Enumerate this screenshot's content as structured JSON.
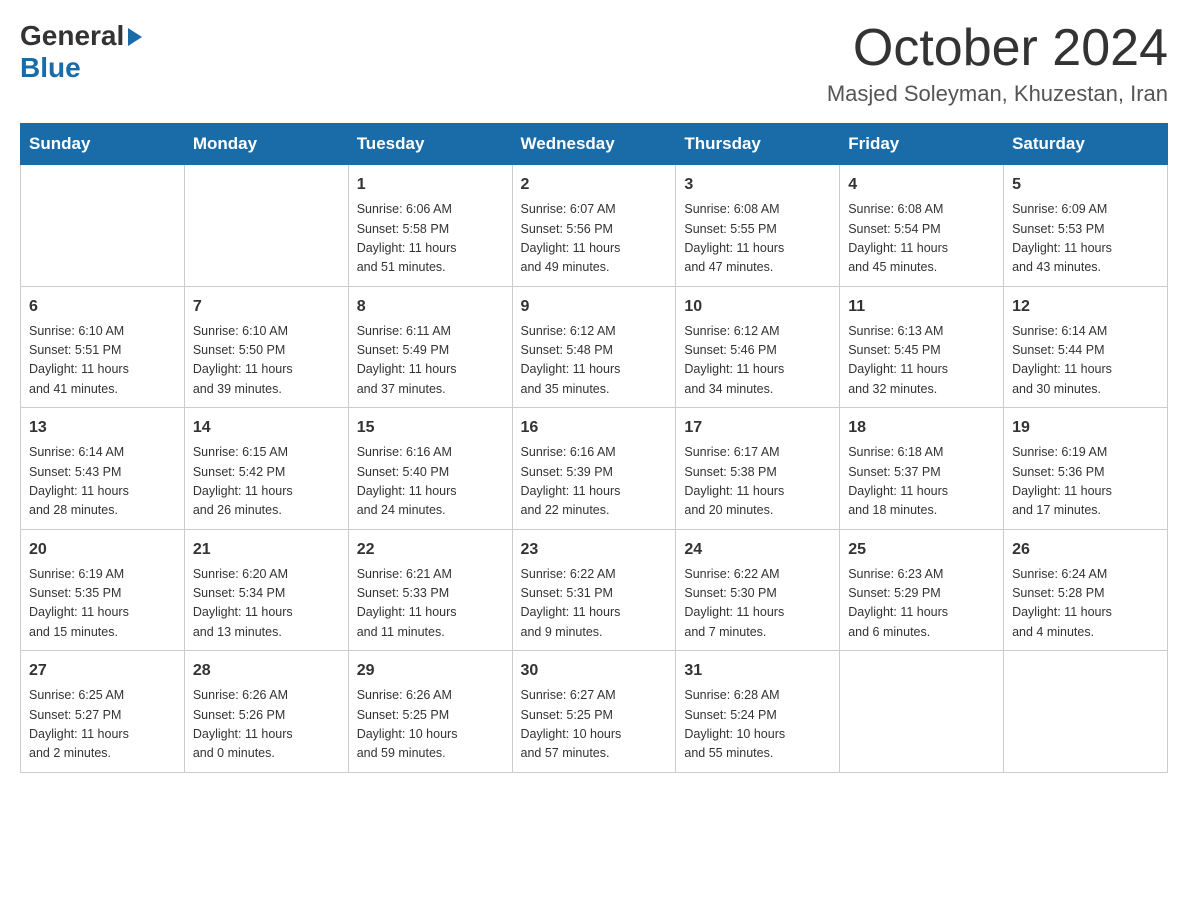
{
  "header": {
    "logo_general": "General",
    "logo_arrow": "▶",
    "logo_blue": "Blue",
    "month_title": "October 2024",
    "location": "Masjed Soleyman, Khuzestan, Iran"
  },
  "days_of_week": [
    "Sunday",
    "Monday",
    "Tuesday",
    "Wednesday",
    "Thursday",
    "Friday",
    "Saturday"
  ],
  "weeks": [
    [
      {
        "day": "",
        "info": ""
      },
      {
        "day": "",
        "info": ""
      },
      {
        "day": "1",
        "info": "Sunrise: 6:06 AM\nSunset: 5:58 PM\nDaylight: 11 hours\nand 51 minutes."
      },
      {
        "day": "2",
        "info": "Sunrise: 6:07 AM\nSunset: 5:56 PM\nDaylight: 11 hours\nand 49 minutes."
      },
      {
        "day": "3",
        "info": "Sunrise: 6:08 AM\nSunset: 5:55 PM\nDaylight: 11 hours\nand 47 minutes."
      },
      {
        "day": "4",
        "info": "Sunrise: 6:08 AM\nSunset: 5:54 PM\nDaylight: 11 hours\nand 45 minutes."
      },
      {
        "day": "5",
        "info": "Sunrise: 6:09 AM\nSunset: 5:53 PM\nDaylight: 11 hours\nand 43 minutes."
      }
    ],
    [
      {
        "day": "6",
        "info": "Sunrise: 6:10 AM\nSunset: 5:51 PM\nDaylight: 11 hours\nand 41 minutes."
      },
      {
        "day": "7",
        "info": "Sunrise: 6:10 AM\nSunset: 5:50 PM\nDaylight: 11 hours\nand 39 minutes."
      },
      {
        "day": "8",
        "info": "Sunrise: 6:11 AM\nSunset: 5:49 PM\nDaylight: 11 hours\nand 37 minutes."
      },
      {
        "day": "9",
        "info": "Sunrise: 6:12 AM\nSunset: 5:48 PM\nDaylight: 11 hours\nand 35 minutes."
      },
      {
        "day": "10",
        "info": "Sunrise: 6:12 AM\nSunset: 5:46 PM\nDaylight: 11 hours\nand 34 minutes."
      },
      {
        "day": "11",
        "info": "Sunrise: 6:13 AM\nSunset: 5:45 PM\nDaylight: 11 hours\nand 32 minutes."
      },
      {
        "day": "12",
        "info": "Sunrise: 6:14 AM\nSunset: 5:44 PM\nDaylight: 11 hours\nand 30 minutes."
      }
    ],
    [
      {
        "day": "13",
        "info": "Sunrise: 6:14 AM\nSunset: 5:43 PM\nDaylight: 11 hours\nand 28 minutes."
      },
      {
        "day": "14",
        "info": "Sunrise: 6:15 AM\nSunset: 5:42 PM\nDaylight: 11 hours\nand 26 minutes."
      },
      {
        "day": "15",
        "info": "Sunrise: 6:16 AM\nSunset: 5:40 PM\nDaylight: 11 hours\nand 24 minutes."
      },
      {
        "day": "16",
        "info": "Sunrise: 6:16 AM\nSunset: 5:39 PM\nDaylight: 11 hours\nand 22 minutes."
      },
      {
        "day": "17",
        "info": "Sunrise: 6:17 AM\nSunset: 5:38 PM\nDaylight: 11 hours\nand 20 minutes."
      },
      {
        "day": "18",
        "info": "Sunrise: 6:18 AM\nSunset: 5:37 PM\nDaylight: 11 hours\nand 18 minutes."
      },
      {
        "day": "19",
        "info": "Sunrise: 6:19 AM\nSunset: 5:36 PM\nDaylight: 11 hours\nand 17 minutes."
      }
    ],
    [
      {
        "day": "20",
        "info": "Sunrise: 6:19 AM\nSunset: 5:35 PM\nDaylight: 11 hours\nand 15 minutes."
      },
      {
        "day": "21",
        "info": "Sunrise: 6:20 AM\nSunset: 5:34 PM\nDaylight: 11 hours\nand 13 minutes."
      },
      {
        "day": "22",
        "info": "Sunrise: 6:21 AM\nSunset: 5:33 PM\nDaylight: 11 hours\nand 11 minutes."
      },
      {
        "day": "23",
        "info": "Sunrise: 6:22 AM\nSunset: 5:31 PM\nDaylight: 11 hours\nand 9 minutes."
      },
      {
        "day": "24",
        "info": "Sunrise: 6:22 AM\nSunset: 5:30 PM\nDaylight: 11 hours\nand 7 minutes."
      },
      {
        "day": "25",
        "info": "Sunrise: 6:23 AM\nSunset: 5:29 PM\nDaylight: 11 hours\nand 6 minutes."
      },
      {
        "day": "26",
        "info": "Sunrise: 6:24 AM\nSunset: 5:28 PM\nDaylight: 11 hours\nand 4 minutes."
      }
    ],
    [
      {
        "day": "27",
        "info": "Sunrise: 6:25 AM\nSunset: 5:27 PM\nDaylight: 11 hours\nand 2 minutes."
      },
      {
        "day": "28",
        "info": "Sunrise: 6:26 AM\nSunset: 5:26 PM\nDaylight: 11 hours\nand 0 minutes."
      },
      {
        "day": "29",
        "info": "Sunrise: 6:26 AM\nSunset: 5:25 PM\nDaylight: 10 hours\nand 59 minutes."
      },
      {
        "day": "30",
        "info": "Sunrise: 6:27 AM\nSunset: 5:25 PM\nDaylight: 10 hours\nand 57 minutes."
      },
      {
        "day": "31",
        "info": "Sunrise: 6:28 AM\nSunset: 5:24 PM\nDaylight: 10 hours\nand 55 minutes."
      },
      {
        "day": "",
        "info": ""
      },
      {
        "day": "",
        "info": ""
      }
    ]
  ]
}
